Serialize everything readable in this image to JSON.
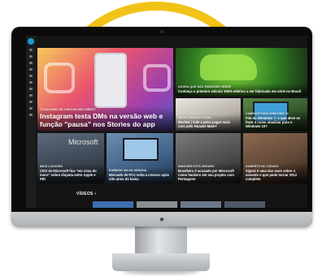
{
  "screen": {
    "featured": {
      "kicker": "TÁ NA HORA DE CHECAR SEU DIRECT",
      "headline": "Instagram testa DMs na versão web e função \"pausa\" nos Stories do app"
    },
    "top_right": {
      "kicker": "AGORA QUE NÃO EMISSÕES VERDE",
      "headline": "Conheça o primeiro veículo 100% elétrico a ser fabricado em série no Brasil"
    },
    "row2": [
      {
        "kicker": "MAIS LUXUOSO",
        "headline": "CEO da Microsoft fica \"em cima do muro\" sobre disputa entre Apple e FBI",
        "image_text": "Microsoft"
      },
      {
        "kicker": "RUBBISH UM NA SEMANA",
        "headline": "Mercado de PCs volta a crescer após oito anos de baixa"
      },
      {
        "kicker": "NINGUÉM ESTÁ SEGURO",
        "headline": "Brasileiro é acusado por Microsoft como hackers em seu projeto com Pentagone"
      },
      {
        "kicker": "AUMENTO NO CÓDIGO",
        "headline": "Signal é uma das mais sobre o assunto e que pode tornar 2012 completo"
      }
    ],
    "mid_right": [
      {
        "kicker": "MAIS LUXUOSO TOTAL",
        "headline": "Review | Vale a pena pagar mais caro pelo Huawei Mate?"
      },
      {
        "kicker": "CAMBIAR PARA WINDOWS 10",
        "headline": "Fim do Windows 7: o que deve se fazer e como atualizar para o Windows 10?"
      }
    ],
    "videos_label": "VÍDEOS ›"
  },
  "colors": {
    "ring": "#f2c218",
    "brand_blue": "#1e9ad6",
    "screen_bg": "#151515"
  }
}
